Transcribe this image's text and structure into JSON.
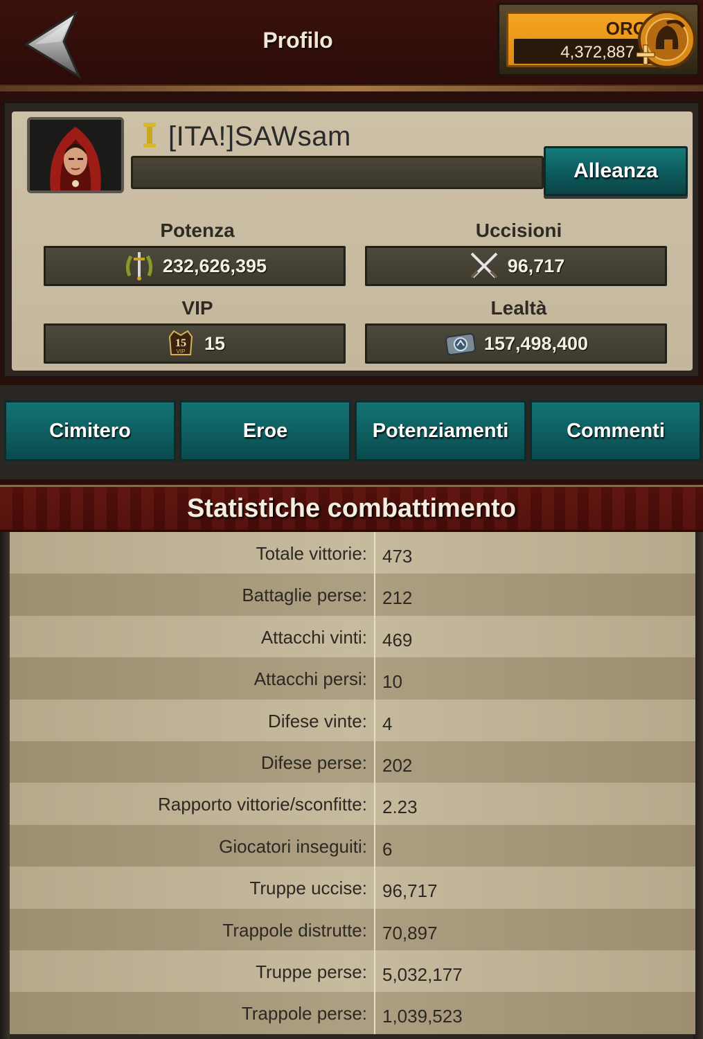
{
  "header": {
    "title": "Profilo",
    "back_icon": "back-arrow-icon",
    "gold": {
      "label": "ORO",
      "value": "4,372,887",
      "icon": "spartan-helmet-icon"
    }
  },
  "profile": {
    "avatar_icon": "hooded-woman-avatar",
    "rank_icon": "rank-i-icon",
    "rank_text": "I",
    "name": "[ITA!]SAWsam",
    "alliance_button": "Alleanza",
    "stats": {
      "power": {
        "label": "Potenza",
        "value": "232,626,395",
        "icon": "laurel-sword-icon"
      },
      "kills": {
        "label": "Uccisioni",
        "value": "96,717",
        "icon": "crossed-swords-icon"
      },
      "vip": {
        "label": "VIP",
        "value": "15",
        "icon": "vip-badge-icon",
        "badge_text": "15",
        "badge_sub": "VIP"
      },
      "loyalty": {
        "label": "Lealtà",
        "value": "157,498,400",
        "icon": "loyalty-token-icon"
      }
    }
  },
  "tabs": [
    {
      "label": "Cimitero"
    },
    {
      "label": "Eroe"
    },
    {
      "label": "Potenziamenti"
    },
    {
      "label": "Commenti"
    }
  ],
  "combat_stats": {
    "title": "Statistiche combattimento",
    "rows": [
      {
        "key": "Totale vittorie:",
        "value": "473"
      },
      {
        "key": "Battaglie perse:",
        "value": "212"
      },
      {
        "key": "Attacchi vinti:",
        "value": "469"
      },
      {
        "key": "Attacchi persi:",
        "value": "10"
      },
      {
        "key": "Difese vinte:",
        "value": "4"
      },
      {
        "key": "Difese perse:",
        "value": "202"
      },
      {
        "key": "Rapporto vittorie/sconfitte:",
        "value": "2.23"
      },
      {
        "key": "Giocatori inseguiti:",
        "value": "6"
      },
      {
        "key": "Truppe uccise:",
        "value": "96,717"
      },
      {
        "key": "Trappole distrutte:",
        "value": "70,897"
      },
      {
        "key": "Truppe perse:",
        "value": "5,032,177"
      },
      {
        "key": "Trappole perse:",
        "value": "1,039,523"
      }
    ]
  },
  "colors": {
    "teal_button": "#0e5e60",
    "gold_bar": "#f4a522",
    "header_bg": "#2b0b08",
    "panel_bg": "#c4b79c"
  }
}
